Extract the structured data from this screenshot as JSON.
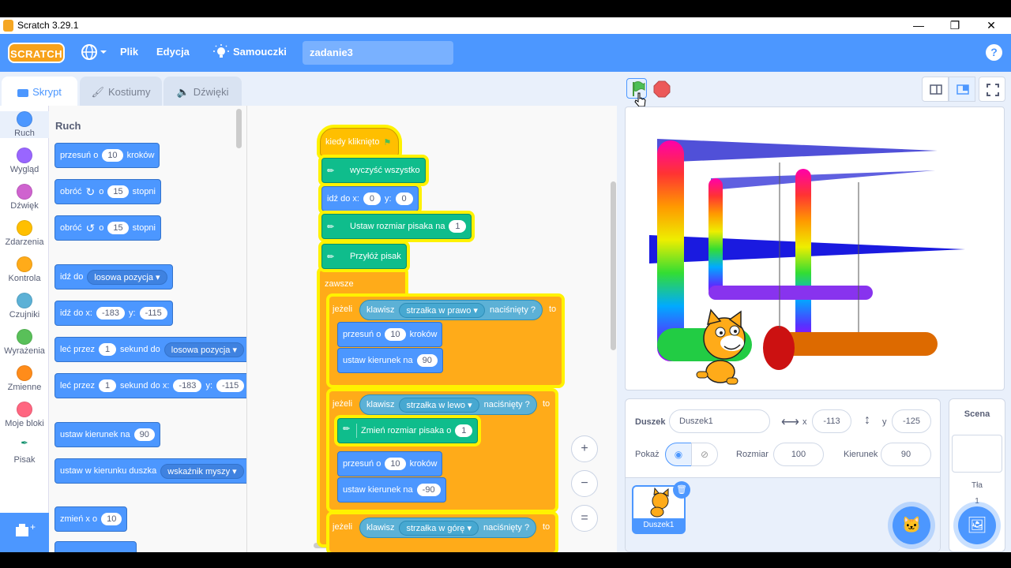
{
  "window": {
    "title": "Scratch 3.29.1",
    "minimize": "—",
    "restore": "❐",
    "close": "✕"
  },
  "menu": {
    "logo": "SCRATCH",
    "file": "Plik",
    "edit": "Edycja",
    "tutorials": "Samouczki",
    "project_title": "zadanie3",
    "help": "?"
  },
  "tabs": {
    "code": "Skrypt",
    "costumes": "Kostiumy",
    "sounds": "Dźwięki"
  },
  "categories": [
    {
      "label": "Ruch",
      "color": "#4c97ff"
    },
    {
      "label": "Wygląd",
      "color": "#9966ff"
    },
    {
      "label": "Dźwięk",
      "color": "#cf63cf"
    },
    {
      "label": "Zdarzenia",
      "color": "#ffbf00"
    },
    {
      "label": "Kontrola",
      "color": "#ffab19"
    },
    {
      "label": "Czujniki",
      "color": "#5cb1d6"
    },
    {
      "label": "Wyrażenia",
      "color": "#59c059"
    },
    {
      "label": "Zmienne",
      "color": "#ff8c1a"
    },
    {
      "label": "Moje bloki",
      "color": "#ff6680"
    },
    {
      "label": "Pisak",
      "color": "#0fbd8c"
    }
  ],
  "palette": {
    "heading": "Ruch",
    "move": {
      "a": "przesuń o",
      "v": "10",
      "b": "kroków"
    },
    "turn_right": {
      "a": "obróć",
      "b": "o",
      "v": "15",
      "c": "stopni"
    },
    "turn_left": {
      "a": "obróć",
      "b": "o",
      "v": "15",
      "c": "stopni"
    },
    "goto": {
      "a": "idź do",
      "d": "losowa pozycja"
    },
    "goto_xy": {
      "a": "idź do x:",
      "x": "-183",
      "b": "y:",
      "y": "-115"
    },
    "glide": {
      "a": "leć przez",
      "v": "1",
      "b": "sekund do",
      "d": "losowa pozycja"
    },
    "glide_xy": {
      "a": "leć przez",
      "v": "1",
      "b": "sekund do x:",
      "x": "-183",
      "c": "y:",
      "y": "-115"
    },
    "point_dir": {
      "a": "ustaw kierunek na",
      "v": "90"
    },
    "point_towards": {
      "a": "ustaw w kierunku duszka",
      "d": "wskaźnik myszy"
    },
    "change_x": {
      "a": "zmień x o",
      "v": "10"
    }
  },
  "script": {
    "hat": "kiedy kliknięto",
    "clear": "wyczyść wszystko",
    "goto": {
      "a": "idź do x:",
      "x": "0",
      "b": "y:",
      "y": "0"
    },
    "pen_size": {
      "a": "Ustaw rozmiar pisaka na",
      "v": "1"
    },
    "pen_down": "Przyłóż pisak",
    "forever": "zawsze",
    "if1": {
      "if": "jeżeli",
      "key": "klawisz",
      "keyname": "strzałka w prawo",
      "pressed": "naciśnięty ?",
      "then": "to"
    },
    "if1_move": {
      "a": "przesuń o",
      "v": "10",
      "b": "kroków"
    },
    "if1_dir": {
      "a": "ustaw kierunek na",
      "v": "90"
    },
    "if2": {
      "if": "jeżeli",
      "key": "klawisz",
      "keyname": "strzałka w lewo",
      "pressed": "naciśnięty ?",
      "then": "to"
    },
    "if2_pen": {
      "a": "Zmień rozmiar pisaka o",
      "v": "1"
    },
    "if2_move": {
      "a": "przesuń o",
      "v": "10",
      "b": "kroków"
    },
    "if2_dir": {
      "a": "ustaw kierunek na",
      "v": "-90"
    },
    "if3": {
      "if": "jeżeli",
      "key": "klawisz",
      "keyname": "strzałka w górę",
      "pressed": "naciśnięty ?",
      "then": "to"
    }
  },
  "zoom": {
    "in": "+",
    "out": "−",
    "reset": "="
  },
  "sprite_info": {
    "sprite_label": "Duszek",
    "sprite_name": "Duszek1",
    "x_label": "x",
    "x": "-113",
    "y_label": "y",
    "y": "-125",
    "show_label": "Pokaż",
    "size_label": "Rozmiar",
    "size": "100",
    "dir_label": "Kierunek",
    "direction": "90"
  },
  "sprite_tile": {
    "name": "Duszek1"
  },
  "scene": {
    "title": "Scena",
    "backdrops_label": "Tła",
    "backdrops_count": "1"
  },
  "colors": {
    "menubar": "#4c97ff",
    "motion": "#4c97ff",
    "pen": "#0fbd8c",
    "control": "#ffab19",
    "events": "#ffbf00",
    "sensing": "#5cb1d6"
  }
}
